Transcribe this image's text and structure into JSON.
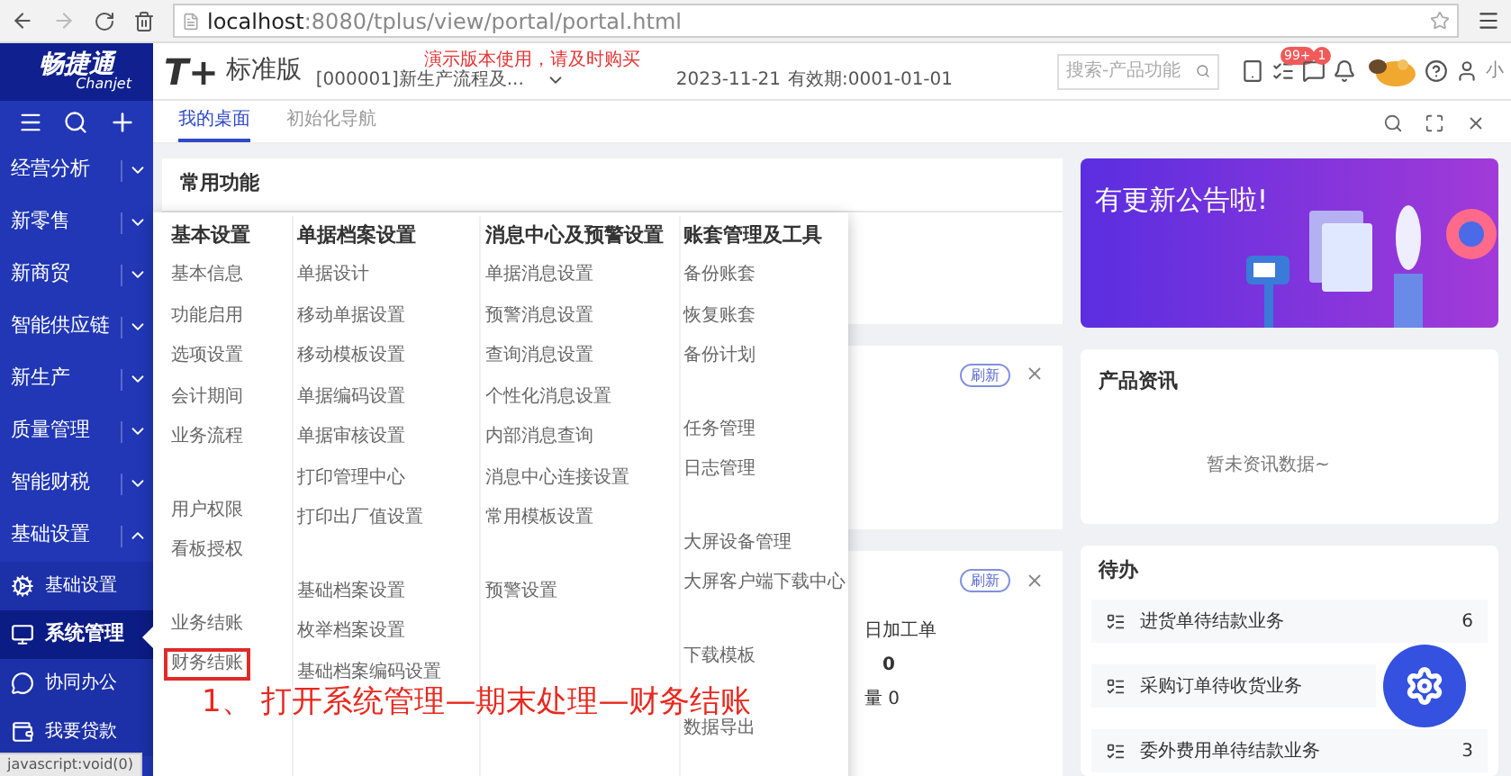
{
  "browser": {
    "host": "localhost",
    "path": ":8080/tplus/view/portal/portal.html",
    "status": "javascript:void(0)"
  },
  "header": {
    "logo_cn": "畅捷通",
    "logo_en": "Chanjet",
    "product": "T+",
    "edition": "标准版",
    "notice": "演示版本使用，请及时购买",
    "account": "[000001]新生产流程及...",
    "date": "2023-11-21",
    "validity": "有效期:0001-01-01",
    "search_placeholder": "搜索-产品功能",
    "task_badge": "99+",
    "message_badge": "1",
    "user": "小"
  },
  "tabs": [
    {
      "label": "我的桌面",
      "selected": true
    },
    {
      "label": "初始化导航",
      "selected": false
    }
  ],
  "sidebar": {
    "items": [
      {
        "label": "经营分析",
        "expanded": false
      },
      {
        "label": "新零售",
        "expanded": false
      },
      {
        "label": "新商贸",
        "expanded": false
      },
      {
        "label": "智能供应链",
        "expanded": false
      },
      {
        "label": "新生产",
        "expanded": false
      },
      {
        "label": "质量管理",
        "expanded": false
      },
      {
        "label": "智能财税",
        "expanded": false
      },
      {
        "label": "基础设置",
        "expanded": true,
        "children": [
          {
            "label": "基础设置",
            "kind": "gear",
            "selected": false
          },
          {
            "label": "系统管理",
            "kind": "monitor",
            "selected": true
          },
          {
            "label": "协同办公",
            "kind": "chat",
            "selected": false
          },
          {
            "label": "我要贷款",
            "kind": "wallet",
            "selected": false
          }
        ]
      }
    ]
  },
  "desk": {
    "common_title": "常用功能",
    "refresh_1": "刷新",
    "refresh_2": "刷新",
    "line_1": "日加工单",
    "line_2": "0",
    "line_3": "量 0"
  },
  "menu": {
    "columns": [
      {
        "title": "基本设置",
        "groups": [
          [
            {
              "label": "基本信息",
              "highlighted": false
            },
            {
              "label": "功能启用",
              "highlighted": false
            },
            {
              "label": "选项设置",
              "highlighted": false
            },
            {
              "label": "会计期间",
              "highlighted": false
            },
            {
              "label": "业务流程",
              "highlighted": false
            }
          ],
          [
            {
              "label": "用户权限",
              "highlighted": false
            },
            {
              "label": "看板授权",
              "highlighted": false
            }
          ],
          [
            {
              "label": "业务结账",
              "highlighted": false
            },
            {
              "label": "财务结账",
              "highlighted": true
            }
          ]
        ]
      },
      {
        "title": "单据档案设置",
        "groups": [
          [
            {
              "label": "单据设计",
              "highlighted": false
            },
            {
              "label": "移动单据设置",
              "highlighted": false
            },
            {
              "label": "移动模板设置",
              "highlighted": false
            },
            {
              "label": "单据编码设置",
              "highlighted": false
            },
            {
              "label": "单据审核设置",
              "highlighted": false
            },
            {
              "label": "打印管理中心",
              "highlighted": false
            },
            {
              "label": "打印出厂值设置",
              "highlighted": false
            }
          ],
          [
            {
              "label": "基础档案设置",
              "highlighted": false
            },
            {
              "label": "枚举档案设置",
              "highlighted": false
            },
            {
              "label": "基础档案编码设置",
              "highlighted": false
            }
          ]
        ]
      },
      {
        "title": "消息中心及预警设置",
        "groups": [
          [
            {
              "label": "单据消息设置",
              "highlighted": false
            },
            {
              "label": "预警消息设置",
              "highlighted": false
            },
            {
              "label": "查询消息设置",
              "highlighted": false
            },
            {
              "label": "个性化消息设置",
              "highlighted": false
            },
            {
              "label": "内部消息查询",
              "highlighted": false
            },
            {
              "label": "消息中心连接设置",
              "highlighted": false
            },
            {
              "label": "常用模板设置",
              "highlighted": false
            }
          ],
          [
            {
              "label": "预警设置",
              "highlighted": false
            }
          ]
        ]
      },
      {
        "title": "账套管理及工具",
        "groups": [
          [
            {
              "label": "备份账套",
              "highlighted": false
            },
            {
              "label": "恢复账套",
              "highlighted": false
            },
            {
              "label": "备份计划",
              "highlighted": false
            }
          ],
          [
            {
              "label": "任务管理",
              "highlighted": false
            },
            {
              "label": "日志管理",
              "highlighted": false
            }
          ],
          [
            {
              "label": "大屏设备管理",
              "highlighted": false
            },
            {
              "label": "大屏客户端下载中心",
              "highlighted": false
            }
          ],
          [
            {
              "label": "下载模板",
              "highlighted": false
            }
          ],
          [
            {
              "label": "数据导出",
              "highlighted": false
            }
          ]
        ]
      }
    ]
  },
  "annotation": "1、 打开系统管理—期末处理—财务结账",
  "right": {
    "banner_title": "有更新公告啦!",
    "news_title": "产品资讯",
    "news_empty": "暂未资讯数据~",
    "todo_title": "待办",
    "todo": [
      {
        "label": "进货单待结款业务",
        "count": "6"
      },
      {
        "label": "采购订单待收货业务"
      },
      {
        "label": "委外费用单待结款业务",
        "count": "3"
      }
    ]
  }
}
